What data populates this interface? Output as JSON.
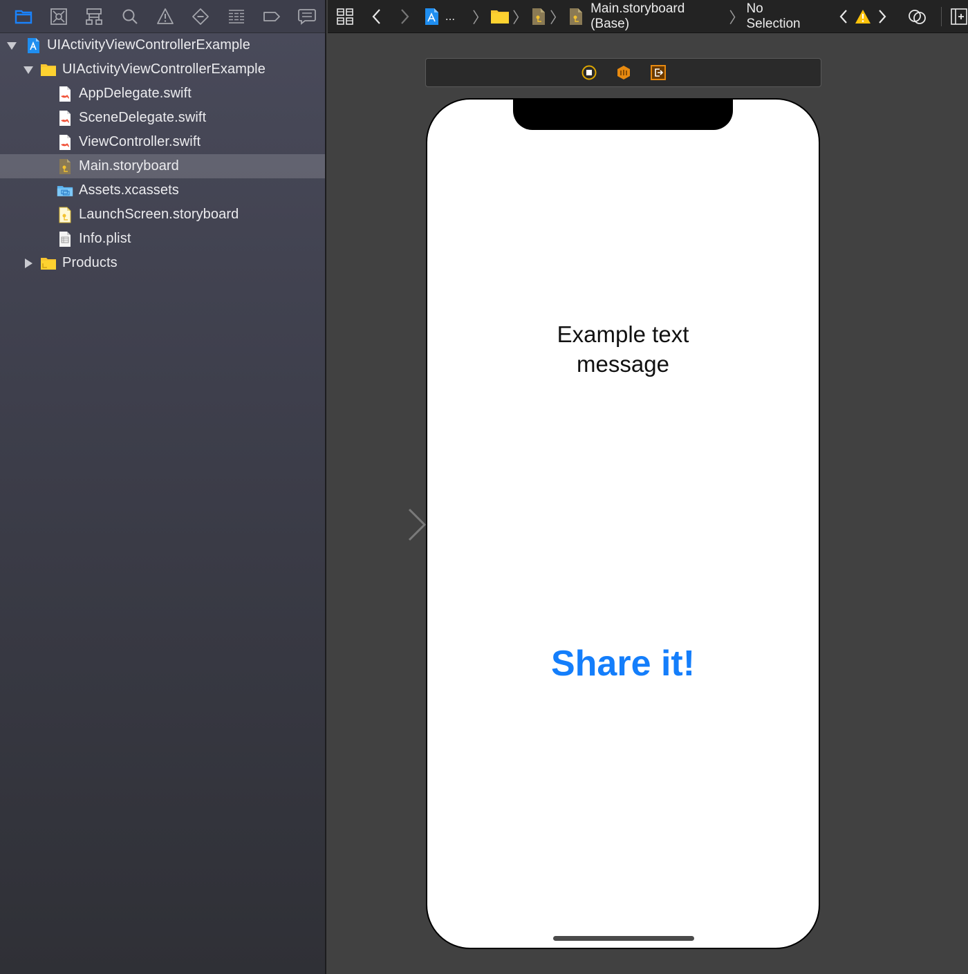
{
  "navigator": {
    "tabs": [
      {
        "name": "project-navigator",
        "icon": "folder-icon",
        "active": true
      },
      {
        "name": "source-control-navigator",
        "icon": "source-control-icon"
      },
      {
        "name": "symbol-navigator",
        "icon": "hierarchy-icon"
      },
      {
        "name": "find-navigator",
        "icon": "search-icon"
      },
      {
        "name": "issue-navigator",
        "icon": "warning-icon"
      },
      {
        "name": "test-navigator",
        "icon": "diamond-minus-icon"
      },
      {
        "name": "debug-navigator",
        "icon": "list-icon"
      },
      {
        "name": "breakpoint-navigator",
        "icon": "breakpoint-icon"
      },
      {
        "name": "report-navigator",
        "icon": "message-icon"
      }
    ],
    "accent_color": "#1a82fb",
    "tree": [
      {
        "label": "UIActivityViewControllerExample",
        "type": "project",
        "depth": 0,
        "expanded": true
      },
      {
        "label": "UIActivityViewControllerExample",
        "type": "folder",
        "depth": 1,
        "expanded": true
      },
      {
        "label": "AppDelegate.swift",
        "type": "swift",
        "depth": 2
      },
      {
        "label": "SceneDelegate.swift",
        "type": "swift",
        "depth": 2
      },
      {
        "label": "ViewController.swift",
        "type": "swift",
        "depth": 2
      },
      {
        "label": "Main.storyboard",
        "type": "storyboard",
        "depth": 2,
        "selected": true
      },
      {
        "label": "Assets.xcassets",
        "type": "assets",
        "depth": 2
      },
      {
        "label": "LaunchScreen.storyboard",
        "type": "storyboard-launch",
        "depth": 2
      },
      {
        "label": "Info.plist",
        "type": "plist",
        "depth": 2
      },
      {
        "label": "Products",
        "type": "folder",
        "depth": 1,
        "expanded": false
      }
    ]
  },
  "jumpbar": {
    "ellipsis": "...",
    "file_label": "Main.storyboard (Base)",
    "selection_label": "No Selection",
    "warning_color": "#fdc20a"
  },
  "canvas": {
    "example_text_line1": "Example text",
    "example_text_line2": "message",
    "share_button_label": "Share it!",
    "share_button_color": "#147efb"
  }
}
